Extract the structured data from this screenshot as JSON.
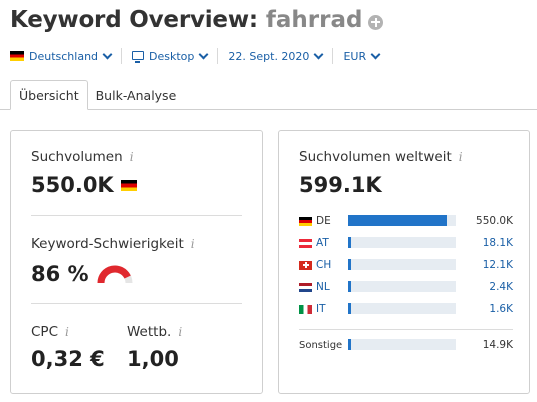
{
  "header": {
    "title": "Keyword Overview:",
    "keyword": "fahrrad",
    "add_icon": "plus-circle-icon"
  },
  "filters": {
    "country": "Deutschland",
    "device": "Desktop",
    "date": "22. Sept. 2020",
    "currency": "EUR"
  },
  "tabs": [
    "Übersicht",
    "Bulk-Analyse"
  ],
  "overview": {
    "search_volume_label": "Suchvolumen",
    "search_volume_value": "550.0K",
    "difficulty_label": "Keyword-Schwierigkeit",
    "difficulty_value": "86 %",
    "difficulty_percent": 86,
    "cpc_label": "CPC",
    "cpc_value": "0,32 €",
    "competition_label": "Wettb.",
    "competition_value": "1,00",
    "info_glyph": "i"
  },
  "worldwide": {
    "label": "Suchvolumen weltweit",
    "value": "599.1K",
    "countries": [
      {
        "code": "DE",
        "volume": "550.0K",
        "share": 0.92
      },
      {
        "code": "AT",
        "volume": "18.1K",
        "share": 0.03
      },
      {
        "code": "CH",
        "volume": "12.1K",
        "share": 0.02
      },
      {
        "code": "NL",
        "volume": "2.4K",
        "share": 0.004
      },
      {
        "code": "IT",
        "volume": "1.6K",
        "share": 0.003
      }
    ],
    "other_label": "Sonstige",
    "other_volume": "14.9K",
    "other_share": 0.025
  },
  "colors": {
    "accent": "#1a5fa6",
    "bar": "#2174c8",
    "gauge": "#e0282e"
  }
}
